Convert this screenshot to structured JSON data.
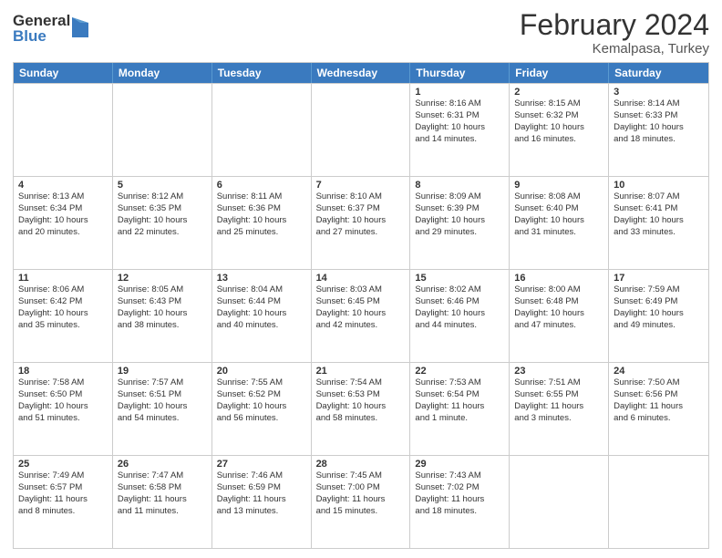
{
  "header": {
    "logo_general": "General",
    "logo_blue": "Blue",
    "title": "February 2024",
    "subtitle": "Kemalpasa, Turkey"
  },
  "days_of_week": [
    "Sunday",
    "Monday",
    "Tuesday",
    "Wednesday",
    "Thursday",
    "Friday",
    "Saturday"
  ],
  "weeks": [
    [
      {
        "day": "",
        "lines": []
      },
      {
        "day": "",
        "lines": []
      },
      {
        "day": "",
        "lines": []
      },
      {
        "day": "",
        "lines": []
      },
      {
        "day": "1",
        "lines": [
          "Sunrise: 8:16 AM",
          "Sunset: 6:31 PM",
          "Daylight: 10 hours",
          "and 14 minutes."
        ]
      },
      {
        "day": "2",
        "lines": [
          "Sunrise: 8:15 AM",
          "Sunset: 6:32 PM",
          "Daylight: 10 hours",
          "and 16 minutes."
        ]
      },
      {
        "day": "3",
        "lines": [
          "Sunrise: 8:14 AM",
          "Sunset: 6:33 PM",
          "Daylight: 10 hours",
          "and 18 minutes."
        ]
      }
    ],
    [
      {
        "day": "4",
        "lines": [
          "Sunrise: 8:13 AM",
          "Sunset: 6:34 PM",
          "Daylight: 10 hours",
          "and 20 minutes."
        ]
      },
      {
        "day": "5",
        "lines": [
          "Sunrise: 8:12 AM",
          "Sunset: 6:35 PM",
          "Daylight: 10 hours",
          "and 22 minutes."
        ]
      },
      {
        "day": "6",
        "lines": [
          "Sunrise: 8:11 AM",
          "Sunset: 6:36 PM",
          "Daylight: 10 hours",
          "and 25 minutes."
        ]
      },
      {
        "day": "7",
        "lines": [
          "Sunrise: 8:10 AM",
          "Sunset: 6:37 PM",
          "Daylight: 10 hours",
          "and 27 minutes."
        ]
      },
      {
        "day": "8",
        "lines": [
          "Sunrise: 8:09 AM",
          "Sunset: 6:39 PM",
          "Daylight: 10 hours",
          "and 29 minutes."
        ]
      },
      {
        "day": "9",
        "lines": [
          "Sunrise: 8:08 AM",
          "Sunset: 6:40 PM",
          "Daylight: 10 hours",
          "and 31 minutes."
        ]
      },
      {
        "day": "10",
        "lines": [
          "Sunrise: 8:07 AM",
          "Sunset: 6:41 PM",
          "Daylight: 10 hours",
          "and 33 minutes."
        ]
      }
    ],
    [
      {
        "day": "11",
        "lines": [
          "Sunrise: 8:06 AM",
          "Sunset: 6:42 PM",
          "Daylight: 10 hours",
          "and 35 minutes."
        ]
      },
      {
        "day": "12",
        "lines": [
          "Sunrise: 8:05 AM",
          "Sunset: 6:43 PM",
          "Daylight: 10 hours",
          "and 38 minutes."
        ]
      },
      {
        "day": "13",
        "lines": [
          "Sunrise: 8:04 AM",
          "Sunset: 6:44 PM",
          "Daylight: 10 hours",
          "and 40 minutes."
        ]
      },
      {
        "day": "14",
        "lines": [
          "Sunrise: 8:03 AM",
          "Sunset: 6:45 PM",
          "Daylight: 10 hours",
          "and 42 minutes."
        ]
      },
      {
        "day": "15",
        "lines": [
          "Sunrise: 8:02 AM",
          "Sunset: 6:46 PM",
          "Daylight: 10 hours",
          "and 44 minutes."
        ]
      },
      {
        "day": "16",
        "lines": [
          "Sunrise: 8:00 AM",
          "Sunset: 6:48 PM",
          "Daylight: 10 hours",
          "and 47 minutes."
        ]
      },
      {
        "day": "17",
        "lines": [
          "Sunrise: 7:59 AM",
          "Sunset: 6:49 PM",
          "Daylight: 10 hours",
          "and 49 minutes."
        ]
      }
    ],
    [
      {
        "day": "18",
        "lines": [
          "Sunrise: 7:58 AM",
          "Sunset: 6:50 PM",
          "Daylight: 10 hours",
          "and 51 minutes."
        ]
      },
      {
        "day": "19",
        "lines": [
          "Sunrise: 7:57 AM",
          "Sunset: 6:51 PM",
          "Daylight: 10 hours",
          "and 54 minutes."
        ]
      },
      {
        "day": "20",
        "lines": [
          "Sunrise: 7:55 AM",
          "Sunset: 6:52 PM",
          "Daylight: 10 hours",
          "and 56 minutes."
        ]
      },
      {
        "day": "21",
        "lines": [
          "Sunrise: 7:54 AM",
          "Sunset: 6:53 PM",
          "Daylight: 10 hours",
          "and 58 minutes."
        ]
      },
      {
        "day": "22",
        "lines": [
          "Sunrise: 7:53 AM",
          "Sunset: 6:54 PM",
          "Daylight: 11 hours",
          "and 1 minute."
        ]
      },
      {
        "day": "23",
        "lines": [
          "Sunrise: 7:51 AM",
          "Sunset: 6:55 PM",
          "Daylight: 11 hours",
          "and 3 minutes."
        ]
      },
      {
        "day": "24",
        "lines": [
          "Sunrise: 7:50 AM",
          "Sunset: 6:56 PM",
          "Daylight: 11 hours",
          "and 6 minutes."
        ]
      }
    ],
    [
      {
        "day": "25",
        "lines": [
          "Sunrise: 7:49 AM",
          "Sunset: 6:57 PM",
          "Daylight: 11 hours",
          "and 8 minutes."
        ]
      },
      {
        "day": "26",
        "lines": [
          "Sunrise: 7:47 AM",
          "Sunset: 6:58 PM",
          "Daylight: 11 hours",
          "and 11 minutes."
        ]
      },
      {
        "day": "27",
        "lines": [
          "Sunrise: 7:46 AM",
          "Sunset: 6:59 PM",
          "Daylight: 11 hours",
          "and 13 minutes."
        ]
      },
      {
        "day": "28",
        "lines": [
          "Sunrise: 7:45 AM",
          "Sunset: 7:00 PM",
          "Daylight: 11 hours",
          "and 15 minutes."
        ]
      },
      {
        "day": "29",
        "lines": [
          "Sunrise: 7:43 AM",
          "Sunset: 7:02 PM",
          "Daylight: 11 hours",
          "and 18 minutes."
        ]
      },
      {
        "day": "",
        "lines": []
      },
      {
        "day": "",
        "lines": []
      }
    ]
  ]
}
